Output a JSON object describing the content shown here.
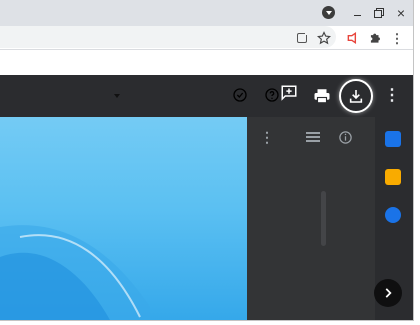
{
  "browser": {
    "window_controls": [
      "minimize",
      "restore",
      "close"
    ],
    "close_glyph": "×",
    "menu_glyph": "⋮",
    "toolbar_icons": [
      "pull-out-icon",
      "star-icon",
      "extension-red-icon",
      "puzzle-icon",
      "chrome-menu-icon"
    ]
  },
  "viewer": {
    "header_icons": [
      "check-circle-icon",
      "help-circle-icon",
      "add-comment-icon",
      "print-icon",
      "download-icon",
      "more-vert-icon"
    ],
    "panel_icons": [
      "more-vert-icon",
      "list-view-icon",
      "info-icon"
    ],
    "sidebar_apps": [
      "calendar-icon",
      "keep-icon",
      "tasks-icon"
    ],
    "more_glyph": "⋮",
    "next_label": "›"
  },
  "colors": {
    "titlebar": "#dee1e6",
    "viewer_bg": "#202124",
    "image_blue": "#5bc0f2",
    "download_ring": "#ffffff",
    "extension_red": "#e8453c"
  }
}
